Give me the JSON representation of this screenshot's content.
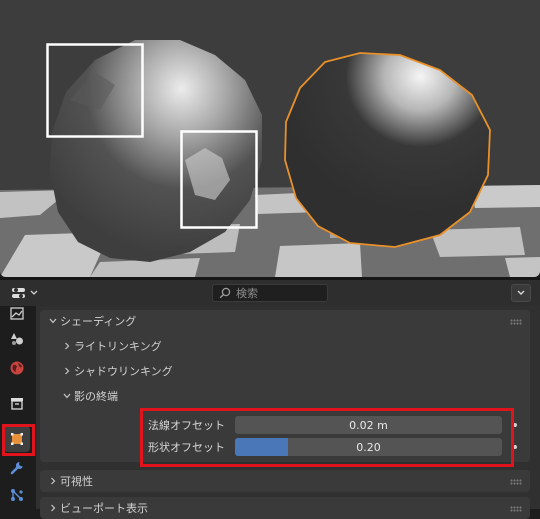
{
  "header": {
    "search_placeholder": "検索",
    "editor_icon": "properties-editor-icon",
    "menu_icon": "chevron-down-icon"
  },
  "tabs": [
    {
      "name": "render-tab",
      "icon": "render-icon",
      "active": false
    },
    {
      "name": "scene-tab",
      "icon": "scene-icon",
      "active": false
    },
    {
      "name": "world-tab",
      "icon": "world-icon",
      "active": false
    },
    {
      "name": "collection-tab",
      "icon": "collection-icon",
      "active": false
    },
    {
      "name": "object-tab",
      "icon": "object-icon",
      "active": true
    },
    {
      "name": "modifier-tab",
      "icon": "wrench-icon",
      "active": false
    },
    {
      "name": "particles-tab",
      "icon": "particles-icon",
      "active": false
    }
  ],
  "panels": {
    "shading": {
      "label": "シェーディング",
      "expanded": true,
      "subpanels": {
        "light_linking": {
          "label": "ライトリンキング",
          "expanded": false
        },
        "shadow_linking": {
          "label": "シャドウリンキング",
          "expanded": false
        },
        "shadow_terminator": {
          "label": "影の終端",
          "expanded": true,
          "normal_offset": {
            "label": "法線オフセット",
            "value": "0.02 m"
          },
          "geometry_offset": {
            "label": "形状オフセット",
            "value": "0.20",
            "fraction": 0.2
          }
        }
      }
    },
    "visibility": {
      "label": "可視性",
      "expanded": false
    },
    "viewport_display": {
      "label": "ビューポート表示",
      "expanded": false
    }
  },
  "colors": {
    "highlight": "#e0141c",
    "selection_outline": "#e8902a",
    "slider_fill": "#4a77b8"
  }
}
